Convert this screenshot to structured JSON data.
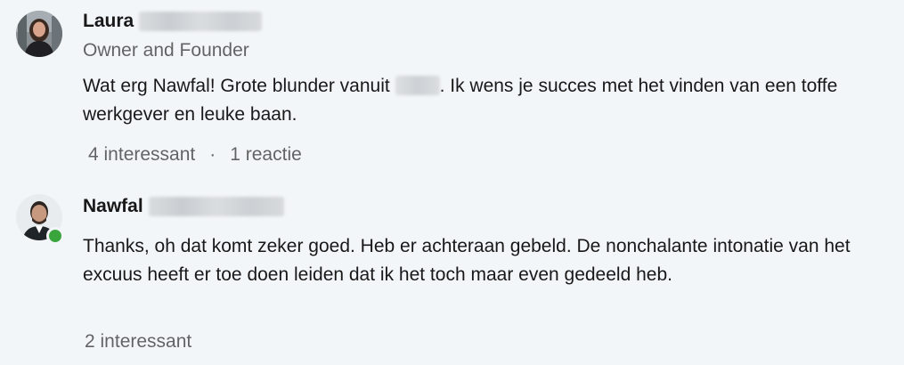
{
  "comments": [
    {
      "author": "Laura",
      "headline": "Owner and Founder",
      "text_before": "Wat erg Nawfal! Grote blunder vanuit ",
      "text_after": ". Ik wens je succes met het vinden van een toffe werkgever en leuke baan.",
      "likes": "4 interessant",
      "separator": "·",
      "replies": "1 reactie"
    },
    {
      "author": "Nawfal",
      "text": "Thanks, oh dat komt zeker goed. Heb er achteraan gebeld. De nonchalante intonatie van het excuus heeft er toe doen leiden dat ik het toch maar even gedeeld heb.",
      "likes": "2 interessant",
      "online": true
    }
  ],
  "colors": {
    "background": "#f3f6f8",
    "presence": "#3aa53d"
  }
}
